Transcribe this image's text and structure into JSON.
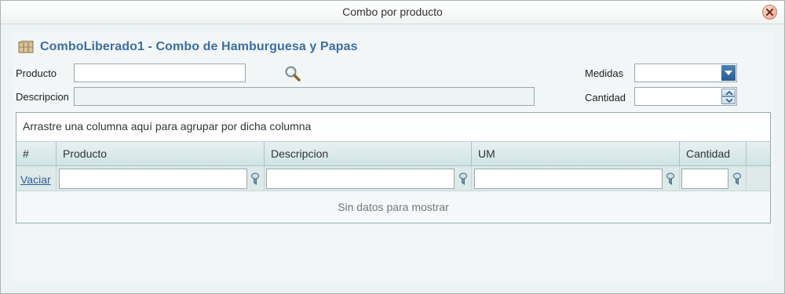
{
  "window": {
    "title": "Combo por producto"
  },
  "header": {
    "title": "ComboLiberado1 - Combo de Hamburguesa y Papas",
    "icon": "box-icon"
  },
  "form": {
    "producto_label": "Producto",
    "producto_value": "",
    "descripcion_label": "Descripcion",
    "descripcion_value": "",
    "medidas_label": "Medidas",
    "medidas_value": "",
    "cantidad_label": "Cantidad",
    "cantidad_value": ""
  },
  "grid": {
    "group_panel_text": "Arrastre una columna aquí para agrupar por dicha columna",
    "columns": [
      "#",
      "Producto",
      "Descripcion",
      "UM",
      "Cantidad"
    ],
    "filter_clear_label": "Vaciar",
    "empty_text": "Sin datos para mostrar"
  },
  "colors": {
    "accent": "#3a6ea5",
    "window_bg": "#eef3f3",
    "header_gradient_top": "#e7f1f2",
    "header_gradient_bottom": "#d0e3e5"
  }
}
